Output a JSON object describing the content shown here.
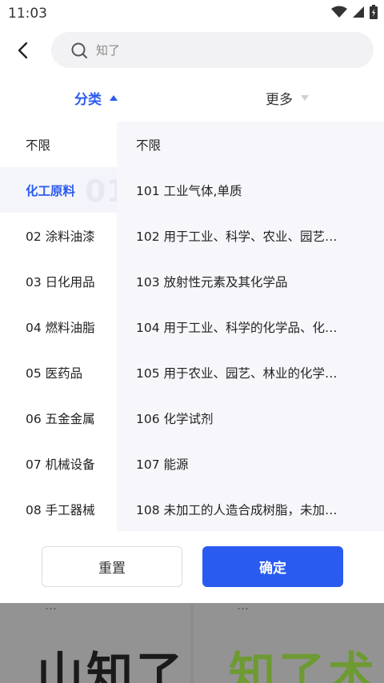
{
  "status": {
    "time": "11:03"
  },
  "search": {
    "query": "知了"
  },
  "filters": {
    "category_label": "分类",
    "more_label": "更多"
  },
  "categories": [
    {
      "label": "不限"
    },
    {
      "label": "化工原料",
      "watermark": "01"
    },
    {
      "label": "02 涂料油漆"
    },
    {
      "label": "03 日化用品"
    },
    {
      "label": "04 燃料油脂"
    },
    {
      "label": "05 医药品"
    },
    {
      "label": "06 五金金属"
    },
    {
      "label": "07 机械设备"
    },
    {
      "label": "08 手工器械"
    }
  ],
  "subcategories": [
    {
      "label": "不限"
    },
    {
      "label": "101 工业气体,单质"
    },
    {
      "label": "102 用于工业、科学、农业、园艺…"
    },
    {
      "label": "103 放射性元素及其化学品"
    },
    {
      "label": "104 用于工业、科学的化学品、化…"
    },
    {
      "label": "105 用于农业、园艺、林业的化学…"
    },
    {
      "label": "106 化学试剂"
    },
    {
      "label": "107 能源"
    },
    {
      "label": "108 未加工的人造合成树脂，未加…"
    }
  ],
  "footer": {
    "reset_label": "重置",
    "confirm_label": "确定"
  },
  "background": {
    "left_label": "…",
    "right_label": "…",
    "left_big": "山知了",
    "right_big": "知了术"
  },
  "colors": {
    "accent": "#2a5bf0",
    "bg_green": "#7aa83a"
  }
}
